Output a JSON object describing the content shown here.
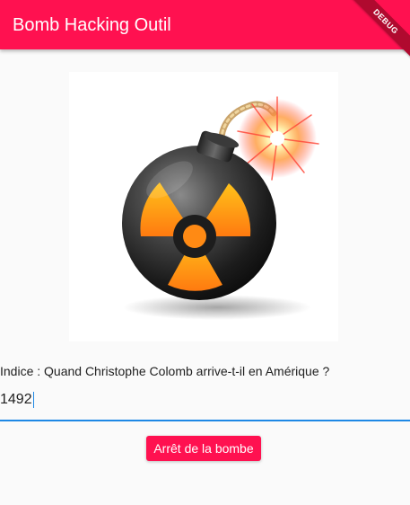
{
  "app": {
    "title": "Bomb Hacking Outil",
    "debug_label": "DEBUG"
  },
  "main": {
    "hint": "Indice : Quand Christophe Colomb arrive-t-il en Amérique ?",
    "answer_value": "1492",
    "stop_button_label": "Arrêt de la bombe"
  },
  "colors": {
    "primary": "#ff1150",
    "focus_accent": "#1e88e5",
    "background": "#fafafa"
  },
  "icons": {
    "bomb_image": "radioactive-bomb-icon"
  }
}
